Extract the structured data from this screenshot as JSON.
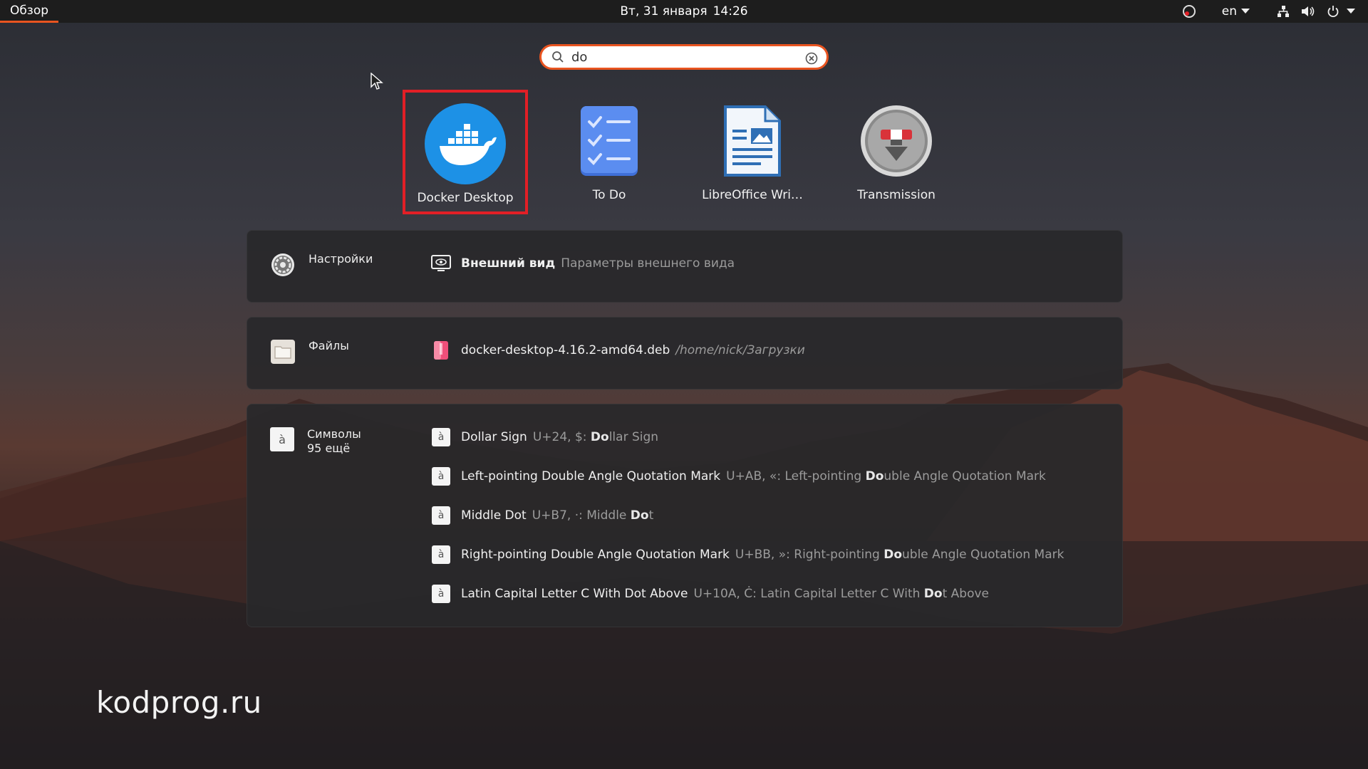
{
  "topbar": {
    "activities": "Обзор",
    "date": "Вт, 31 января",
    "time": "14:26",
    "keyboard_layout": "en"
  },
  "search": {
    "value": "do"
  },
  "apps": [
    {
      "label": "Docker Desktop",
      "icon": "docker-icon",
      "selected": true
    },
    {
      "label": "To Do",
      "icon": "todo-icon",
      "selected": false
    },
    {
      "label": "LibreOffice Wri…",
      "icon": "libreoffice-writer-icon",
      "selected": false
    },
    {
      "label": "Transmission",
      "icon": "transmission-icon",
      "selected": false
    }
  ],
  "settings_panel": {
    "provider": "Настройки",
    "result": {
      "title": "Внешний вид",
      "desc": "Параметры внешнего вида"
    }
  },
  "files_panel": {
    "provider": "Файлы",
    "result": {
      "title": "docker-desktop-4.16.2-amd64.deb",
      "desc": "/home/nick/Загрузки"
    }
  },
  "chars_panel": {
    "provider": "Символы",
    "more": "95 ещё",
    "glyph": "à",
    "results": [
      {
        "title": "Dollar Sign",
        "desc_pre": "U+24, $: ",
        "desc_bold": "Do",
        "desc_post": "llar Sign"
      },
      {
        "title": "Left-pointing Double Angle Quotation Mark",
        "desc_pre": "U+AB, «: Left-pointing ",
        "desc_bold": "Do",
        "desc_post": "uble Angle Quotation Mark"
      },
      {
        "title": "Middle Dot",
        "desc_pre": "U+B7, ·: Middle ",
        "desc_bold": "Do",
        "desc_post": "t"
      },
      {
        "title": "Right-pointing Double Angle Quotation Mark",
        "desc_pre": "U+BB, »: Right-pointing ",
        "desc_bold": "Do",
        "desc_post": "uble Angle Quotation Mark"
      },
      {
        "title": "Latin Capital Letter C With Dot Above",
        "desc_pre": "U+10A, Ċ: Latin Capital Letter C With ",
        "desc_bold": "Do",
        "desc_post": "t Above"
      }
    ]
  },
  "watermark": "kodprog.ru",
  "colors": {
    "accent": "#e95420",
    "selection": "#e21f26",
    "docker": "#1d91e6"
  }
}
